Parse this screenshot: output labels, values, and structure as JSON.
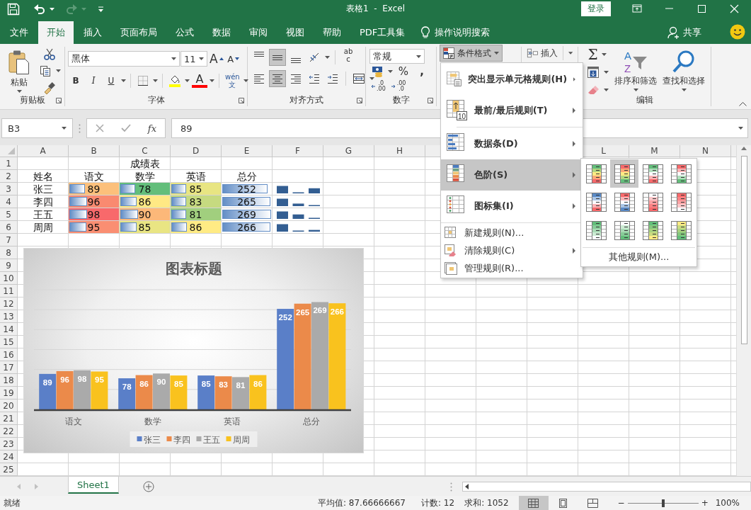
{
  "window": {
    "title": "表格1  -  Excel",
    "sign_in": "登录"
  },
  "quick_access": [
    {
      "kind": "save",
      "disabled": false
    },
    {
      "kind": "undo",
      "disabled": false
    },
    {
      "kind": "redo",
      "disabled": true
    },
    {
      "kind": "customize",
      "disabled": false
    }
  ],
  "ribbon_tabs": [
    {
      "label": "文件",
      "selected": false
    },
    {
      "label": "开始",
      "selected": true
    },
    {
      "label": "插入",
      "selected": false
    },
    {
      "label": "页面布局",
      "selected": false
    },
    {
      "label": "公式",
      "selected": false
    },
    {
      "label": "数据",
      "selected": false
    },
    {
      "label": "审阅",
      "selected": false
    },
    {
      "label": "视图",
      "selected": false
    },
    {
      "label": "帮助",
      "selected": false
    },
    {
      "label": "PDF工具集",
      "selected": false
    }
  ],
  "tell_me": "操作说明搜索",
  "share": "共享",
  "clipboard": {
    "paste": "粘贴",
    "label": "剪贴板"
  },
  "font": {
    "name": "黑体",
    "size": "11",
    "grow": "A",
    "shrink": "A",
    "bold": "B",
    "italic": "I",
    "underline": "U",
    "font_color": "A",
    "phonetic": [
      "wén",
      "文"
    ],
    "label": "字体"
  },
  "alignment": {
    "vertical": [
      {
        "selected": false
      },
      {
        "selected": true
      },
      {
        "selected": false
      }
    ],
    "horizontal": [
      {
        "selected": false
      },
      {
        "selected": true
      },
      {
        "selected": false
      }
    ],
    "wrap": [
      "ab",
      "c"
    ],
    "label": "对齐方式"
  },
  "number": {
    "format": "常规",
    "percent": "%",
    "comma": ",",
    "increase_decimal": [
      ".0",
      ".00"
    ],
    "decrease_decimal": [
      ".00",
      ".0"
    ],
    "label": "数字"
  },
  "styles": {
    "conditional_formatting": "条件格式",
    "expanded": true
  },
  "cells": {
    "insert": "插入"
  },
  "editing": {
    "autosum": "Σ",
    "sort_icon": [
      "A",
      "Z"
    ],
    "sort_filter": "排序和筛选",
    "find_select": "查找和选择",
    "label": "编辑"
  },
  "formula_bar": {
    "name_box": "B3",
    "function_label": "fx",
    "value": "89"
  },
  "sheet": {
    "columns": [
      "A",
      "B",
      "C",
      "D",
      "E",
      "F",
      "G",
      "H",
      "L",
      "M",
      "N"
    ],
    "rows": [
      "1",
      "2",
      "3",
      "4",
      "5",
      "6",
      "7",
      "8",
      "9",
      "10",
      "11",
      "12",
      "13",
      "14",
      "15",
      "16",
      "17",
      "18",
      "19",
      "20",
      "21",
      "22",
      "23",
      "24",
      "25"
    ],
    "title": "成绩表",
    "headers": [
      "姓名",
      "语文",
      "数学",
      "英语",
      "总分"
    ],
    "records": [
      {
        "name": "张三",
        "scores": [
          {
            "value": "89",
            "color": "#fcc07b",
            "level": 0.32
          },
          {
            "value": "78",
            "color": "#63be7b",
            "level": 0.3
          },
          {
            "value": "85",
            "color": "#e8e582",
            "level": 0.3
          }
        ],
        "total": {
          "value": "252",
          "level": 0.92
        }
      },
      {
        "name": "李四",
        "scores": [
          {
            "value": "96",
            "color": "#f98a70",
            "level": 0.35
          },
          {
            "value": "86",
            "color": "#ffe984",
            "level": 0.33
          },
          {
            "value": "83",
            "color": "#c6da80",
            "level": 0.3
          }
        ],
        "total": {
          "value": "265",
          "level": 0.97
        }
      },
      {
        "name": "王五",
        "scores": [
          {
            "value": "98",
            "color": "#f8696b",
            "level": 0.36
          },
          {
            "value": "90",
            "color": "#fcb879",
            "level": 0.35
          },
          {
            "value": "81",
            "color": "#a1cf7e",
            "level": 0.3
          }
        ],
        "total": {
          "value": "269",
          "level": 0.99
        }
      },
      {
        "name": "周周",
        "scores": [
          {
            "value": "95",
            "color": "#fa8e72",
            "level": 0.34
          },
          {
            "value": "85",
            "color": "#e9e583",
            "level": 0.33
          },
          {
            "value": "86",
            "color": "#ffeb84",
            "level": 0.31
          }
        ],
        "total": {
          "value": "266",
          "level": 0.97
        }
      }
    ]
  },
  "chart": {
    "chart_data": {
      "type": "bar",
      "title": "图表标题",
      "categories": [
        "语文",
        "数学",
        "英语",
        "总分"
      ],
      "series": [
        {
          "name": "张三",
          "color": "#5a7fc8",
          "values": [
            89,
            78,
            85,
            252
          ]
        },
        {
          "name": "李四",
          "color": "#eb8a4a",
          "values": [
            96,
            86,
            83,
            265
          ]
        },
        {
          "name": "王五",
          "color": "#aaaaaa",
          "values": [
            98,
            90,
            81,
            269
          ]
        },
        {
          "name": "周周",
          "color": "#f9c21e",
          "values": [
            95,
            85,
            86,
            266
          ]
        }
      ],
      "ylim": [
        0,
        300
      ],
      "data_labels": true,
      "legend": "bottom"
    }
  },
  "sheet_tabs": [
    {
      "label": "Sheet1",
      "selected": true
    }
  ],
  "status_bar": {
    "ready": "就绪",
    "average": "平均值: 87.66666667",
    "count": "计数: 12",
    "sum": "求和: 1052",
    "views": [
      {
        "selected": true
      },
      {
        "selected": false
      },
      {
        "selected": false
      }
    ],
    "zoom_out": "−",
    "zoom_slider": {
      "level": 0.5
    },
    "zoom_in": "+",
    "zoom": "100%"
  },
  "conditional_format_menu": {
    "items": [
      {
        "kind": "large",
        "label": "突出显示单元格规则(H)",
        "submenu": true,
        "selected": false
      },
      {
        "kind": "large",
        "label": "最前/最后规则(T)",
        "submenu": true,
        "selected": false,
        "icon_text": "10"
      },
      {
        "kind": "separator"
      },
      {
        "kind": "large",
        "label": "数据条(D)",
        "submenu": true,
        "selected": false
      },
      {
        "kind": "large",
        "label": "色阶(S)",
        "submenu": true,
        "selected": true
      },
      {
        "kind": "large",
        "label": "图标集(I)",
        "submenu": true,
        "selected": false
      },
      {
        "kind": "separator"
      },
      {
        "kind": "small",
        "label": "新建规则(N)...",
        "submenu": false,
        "selected": false
      },
      {
        "kind": "small",
        "label": "清除规则(C)",
        "submenu": true,
        "selected": false
      },
      {
        "kind": "small",
        "label": "管理规则(R)...",
        "submenu": false,
        "selected": false
      }
    ]
  },
  "color_scale_menu": {
    "scales": [
      {
        "stripes": [
          {
            "color": "#63be7b"
          },
          {
            "color": "#b1d580"
          },
          {
            "color": "#ffeb84"
          },
          {
            "color": "#fbaa77"
          },
          {
            "color": "#f8696b"
          }
        ],
        "selected": false
      },
      {
        "stripes": [
          {
            "color": "#f8696b"
          },
          {
            "color": "#fbaa77"
          },
          {
            "color": "#ffeb84"
          },
          {
            "color": "#b1d580"
          },
          {
            "color": "#63be7b"
          }
        ],
        "selected": true
      },
      {
        "stripes": [
          {
            "color": "#63be7b"
          },
          {
            "color": "#b1dfbd"
          },
          {
            "color": "#fcfcff"
          },
          {
            "color": "#f9b3b5"
          },
          {
            "color": "#f8696b"
          }
        ],
        "selected": false
      },
      {
        "stripes": [
          {
            "color": "#f8696b"
          },
          {
            "color": "#f9b3b5"
          },
          {
            "color": "#fcfcff"
          },
          {
            "color": "#b1dfbd"
          },
          {
            "color": "#63be7b"
          }
        ],
        "selected": false
      },
      {
        "stripes": [
          {
            "color": "#5a8ac6"
          },
          {
            "color": "#abc6e6"
          },
          {
            "color": "#fcfcff"
          },
          {
            "color": "#f9b3b5"
          },
          {
            "color": "#f8696b"
          }
        ],
        "selected": false
      },
      {
        "stripes": [
          {
            "color": "#f8696b"
          },
          {
            "color": "#f9b3b5"
          },
          {
            "color": "#fcfcff"
          },
          {
            "color": "#abc6e6"
          },
          {
            "color": "#5a8ac6"
          }
        ],
        "selected": false
      },
      {
        "stripes": [
          {
            "color": "#fcfcff"
          },
          {
            "color": "#fbc7c9"
          },
          {
            "color": "#faa3a5"
          },
          {
            "color": "#f98385"
          },
          {
            "color": "#f8696b"
          }
        ],
        "selected": false
      },
      {
        "stripes": [
          {
            "color": "#f8696b"
          },
          {
            "color": "#f98385"
          },
          {
            "color": "#faa3a5"
          },
          {
            "color": "#fbc7c9"
          },
          {
            "color": "#fcfcff"
          }
        ],
        "selected": false
      },
      {
        "stripes": [
          {
            "color": "#63be7b"
          },
          {
            "color": "#86cc97"
          },
          {
            "color": "#a9dab5"
          },
          {
            "color": "#ccebd3"
          },
          {
            "color": "#fcfcff"
          }
        ],
        "selected": false
      },
      {
        "stripes": [
          {
            "color": "#fcfcff"
          },
          {
            "color": "#ccebd3"
          },
          {
            "color": "#a9dab5"
          },
          {
            "color": "#86cc97"
          },
          {
            "color": "#63be7b"
          }
        ],
        "selected": false
      },
      {
        "stripes": [
          {
            "color": "#63be7b"
          },
          {
            "color": "#85c77d"
          },
          {
            "color": "#a7d17f"
          },
          {
            "color": "#c9db81"
          },
          {
            "color": "#ffeb84"
          }
        ],
        "selected": false
      },
      {
        "stripes": [
          {
            "color": "#ffeb84"
          },
          {
            "color": "#c9db81"
          },
          {
            "color": "#a7d17f"
          },
          {
            "color": "#85c77d"
          },
          {
            "color": "#63be7b"
          }
        ],
        "selected": false
      }
    ],
    "more": "其他规则(M)..."
  }
}
